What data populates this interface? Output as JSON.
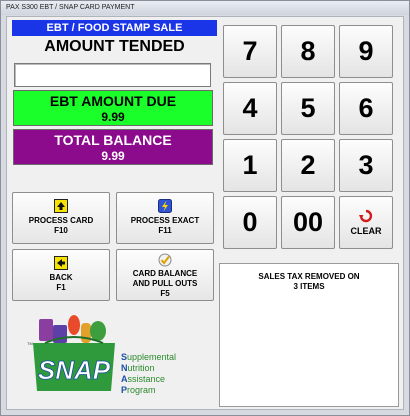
{
  "window": {
    "title": "PAX S300 EBT / SNAP CARD PAYMENT"
  },
  "sale": {
    "header": "EBT / FOOD STAMP SALE",
    "tendered_label": "AMOUNT TENDED",
    "tendered_value": "",
    "due_label": "EBT AMOUNT DUE",
    "due_value": "9.99",
    "balance_label": "TOTAL BALANCE",
    "balance_value": "9.99"
  },
  "keypad": {
    "k7": "7",
    "k8": "8",
    "k9": "9",
    "k4": "4",
    "k5": "5",
    "k6": "6",
    "k1": "1",
    "k2": "2",
    "k3": "3",
    "k0": "0",
    "k00": "00",
    "clear": "CLEAR"
  },
  "functions": {
    "process_card": [
      "PROCESS CARD",
      "F10"
    ],
    "process_exact": [
      "PROCESS EXACT",
      "F11"
    ],
    "back": [
      "BACK",
      "F1"
    ],
    "card_balance": [
      "CARD BALANCE",
      "AND PULL OUTS",
      "F5"
    ]
  },
  "message": [
    "SALES TAX REMOVED ON",
    "3 ITEMS"
  ],
  "snap": {
    "logo_text": "SNAP",
    "tm": "TM",
    "initials": [
      "S",
      "N",
      "A",
      "P"
    ],
    "rests": [
      "upplemental",
      "utrition",
      "ssistance",
      "rogram"
    ]
  },
  "colors": {
    "header_blue": "#1a35e8",
    "due_green": "#1aff2a",
    "balance_purple": "#8c0a8c"
  }
}
